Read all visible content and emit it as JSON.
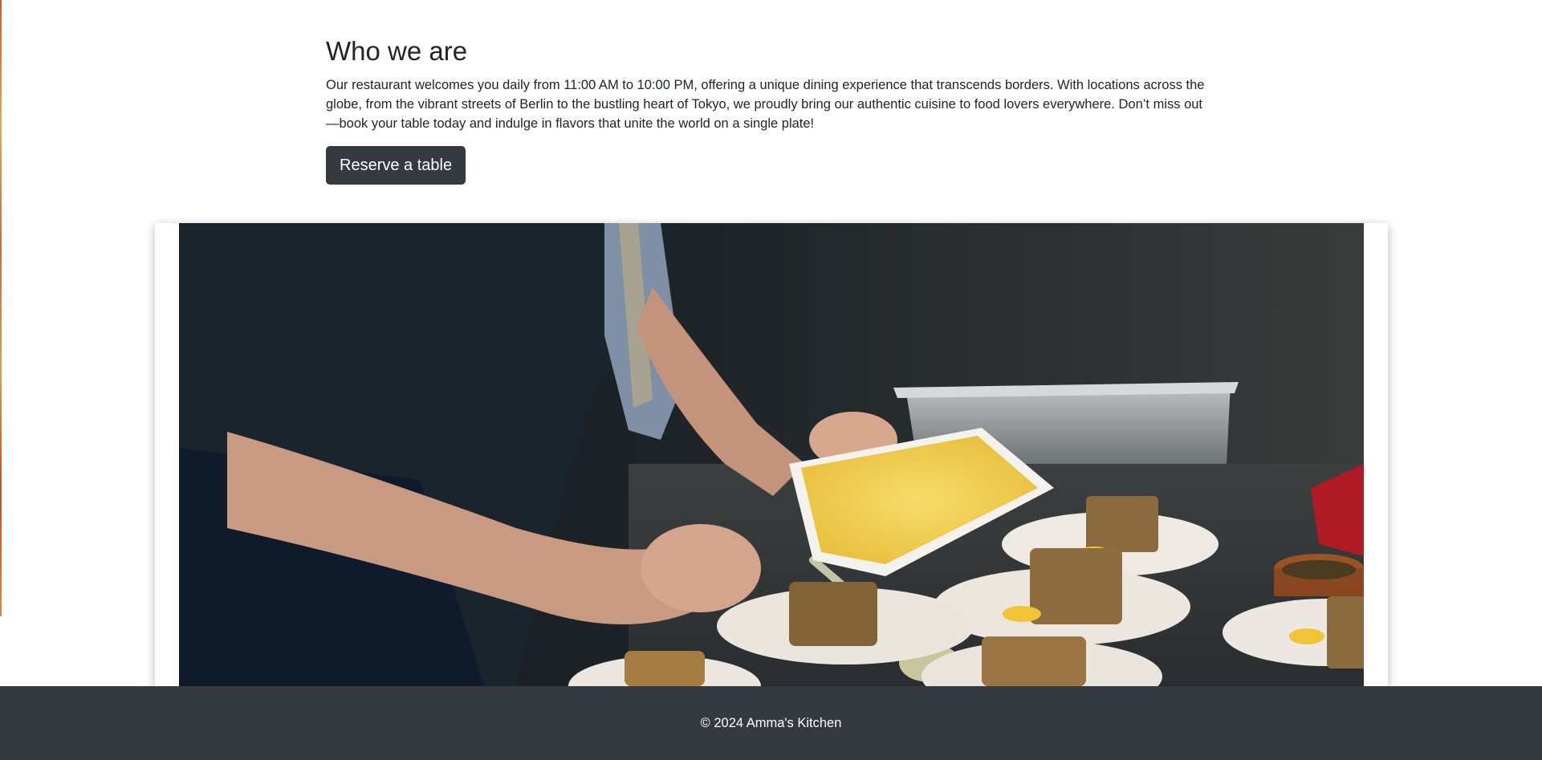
{
  "about": {
    "heading": "Who we are",
    "body": "Our restaurant welcomes you daily from 11:00 AM to 10:00 PM, offering a unique dining experience that transcends borders. With locations across the globe, from the vibrant streets of Berlin to the bustling heart of Tokyo, we proudly bring our authentic cuisine to food lovers everywhere. Don’t miss out—book your table today and indulge in flavors that unite the world on a single plate!",
    "button_label": "Reserve a table"
  },
  "footer": {
    "text": "© 2024 Amma's Kitchen"
  },
  "colors": {
    "button_bg": "#343a40",
    "footer_bg": "#343a40",
    "text": "#212529"
  }
}
